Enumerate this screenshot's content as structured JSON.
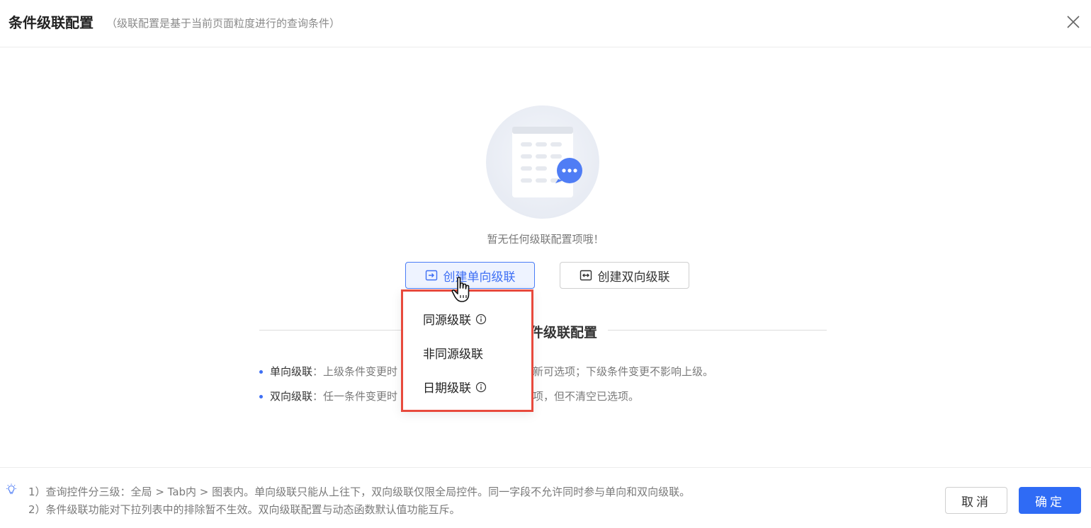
{
  "dialog": {
    "title": "条件级联配置",
    "subtitle": "（级联配置是基于当前页面粒度进行的查询条件）",
    "close_icon": "close-icon"
  },
  "empty_state": {
    "message": "暂无任何级联配置项哦！"
  },
  "actions": {
    "create_single": "创建单向级联",
    "create_double": "创建双向级联"
  },
  "dropdown": {
    "items": [
      {
        "label": "同源级联",
        "info_icon": true
      },
      {
        "label": "非同源级联",
        "info_icon": false
      },
      {
        "label": "日期级联",
        "info_icon": true
      }
    ]
  },
  "section": {
    "title": "件级联配置",
    "rows": [
      {
        "term": "单向级联",
        "lead": "：上级条件变更时",
        "tail": "新可选项；下级条件变更不影响上级。"
      },
      {
        "term": "双向级联",
        "lead": "：任一条件变更时",
        "tail": "项，但不清空已选项。"
      }
    ]
  },
  "footer": {
    "notes": [
      "1）查询控件分三级：全局 > Tab内 > 图表内。单向级联只能从上往下，双向级联仅限全局控件。同一字段不允许同时参与单向和双向级联。",
      "2）条件级联功能对下拉列表中的排除暂不生效。双向级联配置与动态函数默认值功能互斥。"
    ],
    "cancel": "取消",
    "confirm": "确定"
  },
  "colors": {
    "primary": "#2f6bf5",
    "highlight_border": "#e84a3d"
  }
}
